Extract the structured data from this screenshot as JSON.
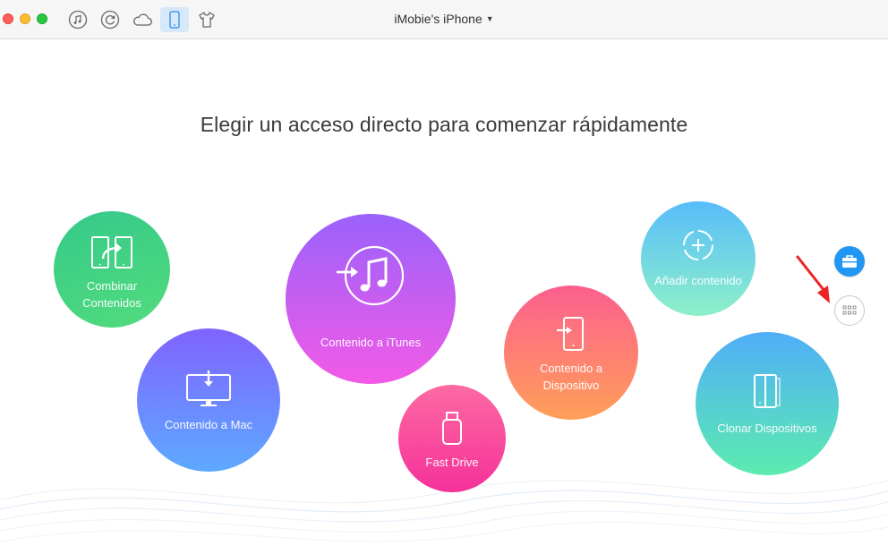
{
  "window": {
    "device_title": "iMobie's iPhone",
    "toolbar_icons": [
      "music-icon",
      "restore-icon",
      "cloud-icon",
      "phone-icon",
      "tshirt-icon"
    ],
    "active_toolbar_icon": "phone-icon"
  },
  "main": {
    "heading": "Elegir un acceso directo para comenzar rápidamente",
    "shortcuts": {
      "combinar": {
        "line1": "Combinar",
        "line2": "Contenidos",
        "icon": "merge-devices-icon"
      },
      "mac": {
        "label": "Contenido a Mac",
        "icon": "monitor-download-icon"
      },
      "itunes": {
        "label": "Contenido a iTunes",
        "icon": "itunes-icon"
      },
      "fast_drive": {
        "label": "Fast Drive",
        "icon": "usb-drive-icon"
      },
      "dispositivo": {
        "line1": "Contenido a",
        "line2": "Dispositivo",
        "icon": "phone-import-icon"
      },
      "anadir": {
        "label": "Añadir contenido",
        "icon": "add-content-icon"
      },
      "clonar": {
        "label": "Clonar Dispositivos",
        "icon": "clone-devices-icon"
      }
    },
    "side_buttons": [
      "toolbox-icon",
      "grid-icon"
    ]
  },
  "colors": {
    "accent": "#2196f3",
    "combinar": "#3fd283",
    "mac": "#6f86ff",
    "itunes": "#c25ef0",
    "fast_drive": "#f8489e",
    "dispositivo": "#fd7c75",
    "anadir": "#72d6e2",
    "clonar": "#56cdd3",
    "annotation_arrow": "#ee2222"
  }
}
